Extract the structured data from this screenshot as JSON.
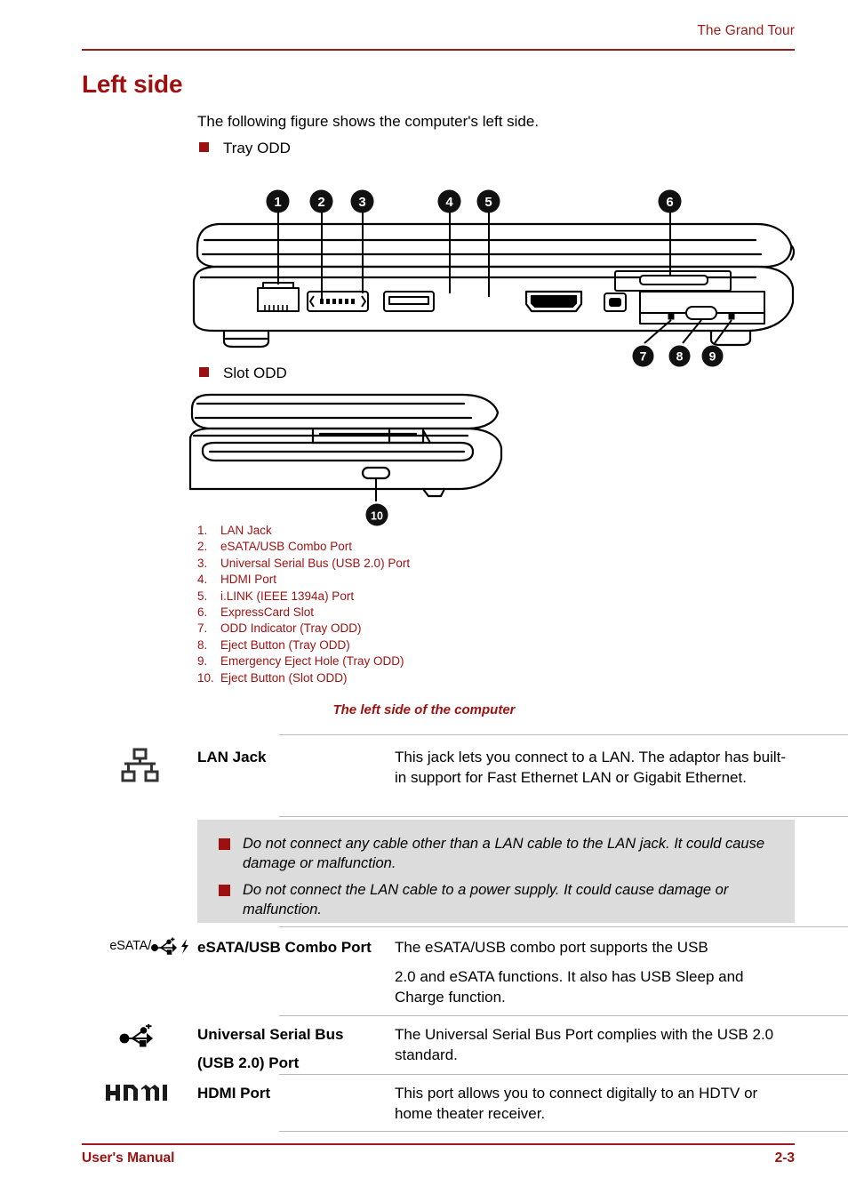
{
  "header": {
    "chapter": "The Grand Tour"
  },
  "title": "Left side",
  "intro": {
    "paragraph": "The following figure shows the computer's left side.",
    "bullets": [
      {
        "label": "Tray ODD"
      },
      {
        "label": "Slot ODD"
      }
    ]
  },
  "figure": {
    "caption": "The left side of the computer",
    "tray_callouts": [
      "1",
      "2",
      "3",
      "4",
      "5",
      "6",
      "7",
      "8",
      "9"
    ],
    "slot_callouts": [
      "10"
    ]
  },
  "legend": [
    {
      "num": "1.",
      "text": "LAN Jack"
    },
    {
      "num": "2.",
      "text": "eSATA/USB Combo Port"
    },
    {
      "num": "3.",
      "text": "Universal Serial Bus (USB 2.0) Port"
    },
    {
      "num": "4.",
      "text": "HDMI Port"
    },
    {
      "num": "5.",
      "text": "i.LINK (IEEE 1394a) Port"
    },
    {
      "num": "6.",
      "text": "ExpressCard Slot"
    },
    {
      "num": "7.",
      "text": "ODD Indicator (Tray ODD)"
    },
    {
      "num": "8.",
      "text": "Eject Button (Tray ODD)"
    },
    {
      "num": "9.",
      "text": "Emergency Eject Hole (Tray ODD)"
    },
    {
      "num": "10.",
      "text": "Eject Button (Slot ODD)"
    }
  ],
  "spec_rows": [
    {
      "icon": "lan-network-icon",
      "name": "LAN Jack",
      "desc1": "This jack lets you connect to a LAN. The adaptor has built-in support for Fast Ethernet LAN or Gigabit Ethernet.",
      "desc2": ""
    },
    {
      "icon": "esata-usb-charge-icon",
      "icon_text": "eSATA/",
      "name": "eSATA/USB Combo Port",
      "desc1": "The eSATA/USB combo port supports the USB",
      "desc2": "2.0 and eSATA functions. It also has USB Sleep and Charge function."
    },
    {
      "icon": "usb-trident-icon",
      "name": "Universal Serial Bus (USB 2.0) Port",
      "name_line1": "Universal Serial Bus",
      "name_line2": "(USB 2.0) Port",
      "desc1": "The Universal Serial Bus Port complies with the USB 2.0 standard.",
      "desc2": ""
    },
    {
      "icon": "hdmi-logo-icon",
      "icon_text": "HDMI",
      "name": "HDMI Port",
      "desc1": "This port allows you to connect digitally to an HDTV or home theater receiver.",
      "desc2": ""
    }
  ],
  "warnings": [
    {
      "text": "Do not connect any cable other than a LAN cable to the LAN jack. It could cause damage or malfunction."
    },
    {
      "text": "Do not connect the LAN cable to a power supply. It could cause damage or malfunction."
    }
  ],
  "footer": {
    "left": "User's Manual",
    "right": "2-3"
  },
  "colors": {
    "brand_red": "#9e1010",
    "rule_red": "#9e1b1b",
    "warn_bg": "#dcdcdc",
    "table_rule": "#b9b9b9"
  }
}
